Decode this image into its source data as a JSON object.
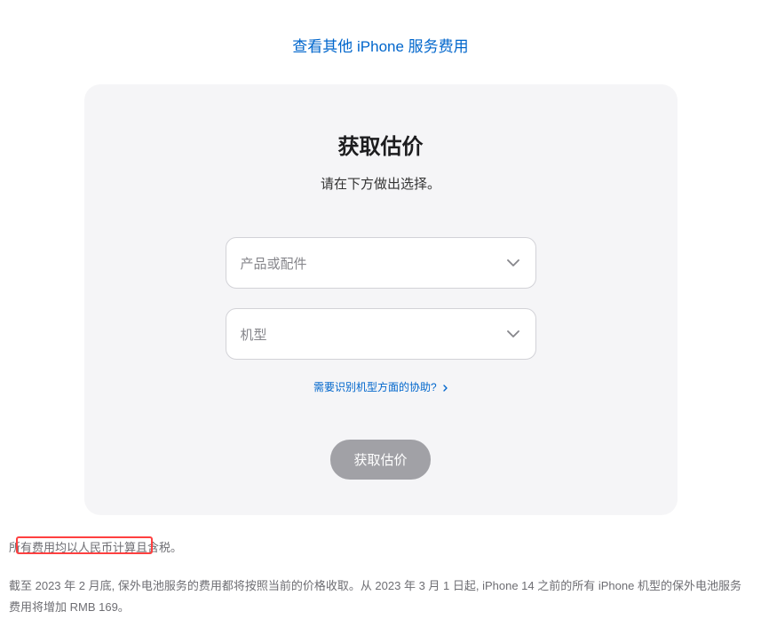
{
  "topLink": {
    "label": "查看其他 iPhone 服务费用"
  },
  "card": {
    "title": "获取估价",
    "subtitle": "请在下方做出选择。",
    "select1": {
      "placeholder": "产品或配件"
    },
    "select2": {
      "placeholder": "机型"
    },
    "helpLink": {
      "label": "需要识别机型方面的协助?"
    },
    "submitButton": {
      "label": "获取估价"
    }
  },
  "footer": {
    "line1": "所有费用均以人民币计算且含税。",
    "line2": "截至 2023 年 2 月底, 保外电池服务的费用都将按照当前的价格收取。从 2023 年 3 月 1 日起, iPhone 14 之前的所有 iPhone 机型的保外电池服务费用将增加 RMB 169。"
  }
}
